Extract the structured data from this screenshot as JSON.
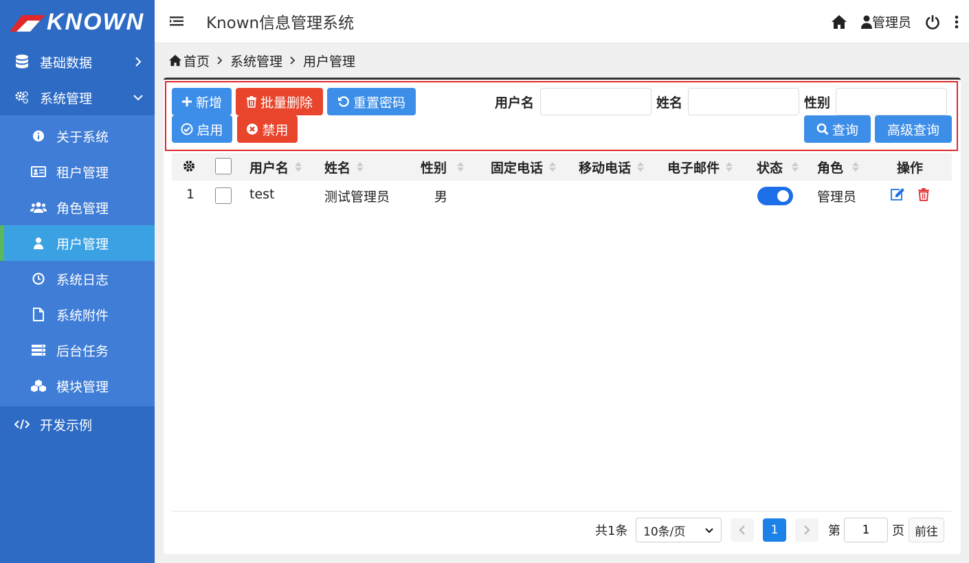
{
  "brand": {
    "logo_text": "KNOWN",
    "logo_color": "#e0272b"
  },
  "header": {
    "title": "Known信息管理系统",
    "user": "管理员"
  },
  "sidebar": {
    "items": [
      {
        "label": "基础数据",
        "icon": "database-icon"
      },
      {
        "label": "系统管理",
        "icon": "gears-icon"
      }
    ],
    "sub_items": [
      {
        "label": "关于系统",
        "icon": "info-icon"
      },
      {
        "label": "租户管理",
        "icon": "id-card-icon"
      },
      {
        "label": "角色管理",
        "icon": "users-icon"
      },
      {
        "label": "用户管理",
        "icon": "user-icon",
        "active": true
      },
      {
        "label": "系统日志",
        "icon": "clock-icon"
      },
      {
        "label": "系统附件",
        "icon": "file-icon"
      },
      {
        "label": "后台任务",
        "icon": "tasks-icon"
      },
      {
        "label": "模块管理",
        "icon": "cubes-icon"
      }
    ],
    "bottom": {
      "label": "开发示例",
      "icon": "code-icon"
    }
  },
  "breadcrumb": [
    "首页",
    "系统管理",
    "用户管理"
  ],
  "toolbar": {
    "add": "新增",
    "batch_delete": "批量删除",
    "reset_password": "重置密码",
    "enable": "启用",
    "disable": "禁用",
    "query": "查询",
    "advanced_query": "高级查询"
  },
  "filters": {
    "username_label": "用户名",
    "username_value": "",
    "name_label": "姓名",
    "name_value": "",
    "gender_label": "性别",
    "gender_value": ""
  },
  "table": {
    "columns": [
      "用户名",
      "姓名",
      "性别",
      "固定电话",
      "移动电话",
      "电子邮件",
      "状态",
      "角色",
      "操作"
    ],
    "rows": [
      {
        "index": "1",
        "username": "test",
        "name": "测试管理员",
        "gender": "男",
        "phone": "",
        "mobile": "",
        "email": "",
        "enabled": true,
        "role": "管理员"
      }
    ]
  },
  "pagination": {
    "total": "共1条",
    "page_size": "10条/页",
    "current_page": "1",
    "goto_prefix": "第",
    "goto_value": "1",
    "goto_suffix": "页",
    "goto_button": "前往"
  },
  "colors": {
    "sidebar": "#2d6bc5",
    "primary": "#3d8ee8",
    "danger": "#e8452c",
    "active": "#3aa2e3",
    "active_marker": "#5cb85c"
  }
}
